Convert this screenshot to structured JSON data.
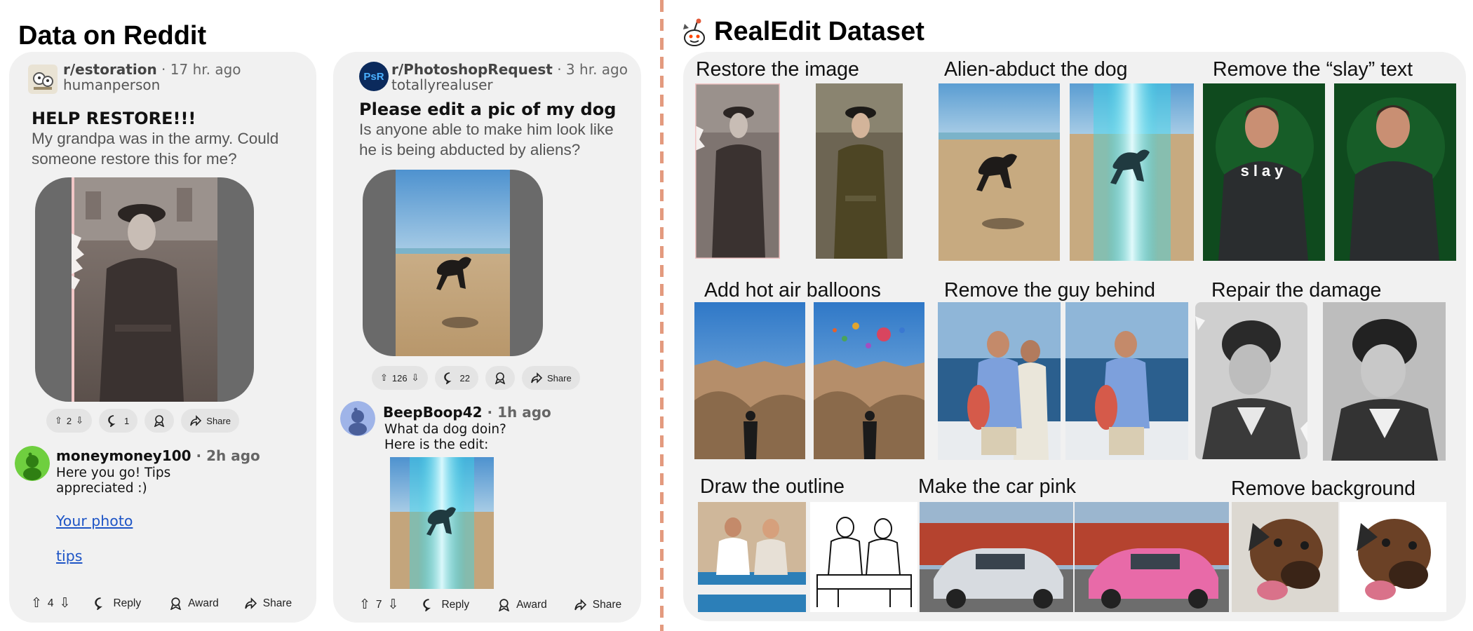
{
  "left_header": {
    "title": "Data on Reddit"
  },
  "right_header": {
    "title": "RealEdit Dataset"
  },
  "post1": {
    "subreddit": "r/estoration",
    "time": " · 17 hr. ago",
    "user": "humanperson",
    "title": "HELP RESTORE!!!",
    "body": "My grandpa was in the army. Could someone restore this for me?",
    "votes": "2",
    "comments": "1",
    "share": "Share"
  },
  "comment1": {
    "user": "moneymoney100",
    "time": " · 2h ago",
    "text_line1": "Here you go! Tips",
    "text_line2": "appreciated :)",
    "link1": "Your photo",
    "link2": "tips",
    "votes": "4",
    "reply": "Reply",
    "award": "Award",
    "share": "Share"
  },
  "post2": {
    "subreddit": "r/PhotoshopRequest",
    "time": " · 3 hr. ago",
    "user": "totallyrealuser",
    "icon_text": "PsR",
    "title": "Please edit a pic of my dog",
    "body": "Is anyone able to make him look like he is being abducted by aliens?",
    "votes": "126",
    "comments": "22",
    "share": "Share"
  },
  "comment2": {
    "user": "BeepBoop42",
    "time": " · 1h ago",
    "text_line1": "What da dog doin?",
    "text_line2": "Here is the edit:",
    "votes": "7",
    "reply": "Reply",
    "award": "Award",
    "share": "Share"
  },
  "dataset": {
    "captions": [
      "Restore the image",
      "Alien-abduct the dog",
      "Remove the “slay” text",
      "Add hot air balloons",
      "Remove the guy behind",
      "Repair the damage",
      "Draw the outline",
      "Make the car pink",
      "Remove background"
    ],
    "slay_text": "slay"
  },
  "colors": {
    "panel": "#f1f1f1",
    "divider": "#e39a7e",
    "link": "#1e55c6",
    "alien_beam": "#39d6e8",
    "pink_car": "#e86aa8"
  }
}
